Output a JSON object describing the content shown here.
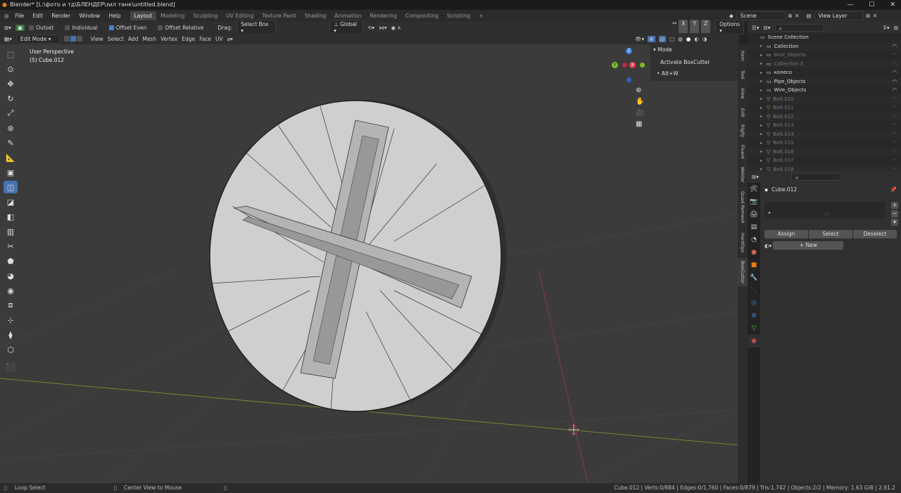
{
  "title_bar": {
    "text": "Blender* [L:\\фото и тд\\БЛЕНДЕР\\зил танк\\untitled.blend]"
  },
  "menu": [
    "File",
    "Edit",
    "Render",
    "Window",
    "Help"
  ],
  "workspaces": [
    "Layout",
    "Modeling",
    "Sculpting",
    "UV Editing",
    "Texture Paint",
    "Shading",
    "Animation",
    "Rendering",
    "Compositing",
    "Scripting"
  ],
  "scene": {
    "label": "Scene",
    "view_layer": "View Layer"
  },
  "tool_settings": {
    "outset": "Outset",
    "individual": "Individual",
    "offset_even": "Offset Even",
    "offset_relative": "Offset Relative",
    "drag_label": "Drag:",
    "drag_value": "Select Box",
    "orientation": "Global",
    "options": "Options"
  },
  "viewport_header": {
    "mode": "Edit Mode",
    "items": [
      "View",
      "Select",
      "Add",
      "Mesh",
      "Vertex",
      "Edge",
      "Face",
      "UV"
    ]
  },
  "viewport": {
    "perspective": "User Perspective",
    "object": "(5) Cube.012"
  },
  "gizmo": {
    "x": "X",
    "y": "Y",
    "z": "Z",
    "colors": {
      "x": "#e0404f",
      "y": "#7fbd2a",
      "z": "#3d84e6"
    }
  },
  "npanel": {
    "header": "Mode",
    "activate": "Activate BoxCutter",
    "shortcut": "• Alt+W",
    "tabs": [
      "Item",
      "Tool",
      "View",
      "Edit",
      "Rigify",
      "Fluent",
      "Welder",
      "Quad Remesh",
      "HardOps",
      "BoxCutter"
    ]
  },
  "outliner": {
    "root": "Scene Collection",
    "rows": [
      {
        "name": "Collection",
        "dim": false,
        "indent": 1
      },
      {
        "name": "Bool_Objects",
        "dim": true,
        "indent": 1
      },
      {
        "name": "Collection 3",
        "dim": true,
        "indent": 1
      },
      {
        "name": "колесо",
        "dim": false,
        "indent": 1
      },
      {
        "name": "Pipe_Objects",
        "dim": false,
        "indent": 1
      },
      {
        "name": "Wire_Objects",
        "dim": false,
        "indent": 1
      },
      {
        "name": "Bolt.010",
        "dim": true,
        "indent": 1
      },
      {
        "name": "Bolt.011",
        "dim": true,
        "indent": 1
      },
      {
        "name": "Bolt.012",
        "dim": true,
        "indent": 1
      },
      {
        "name": "Bolt.013",
        "dim": true,
        "indent": 1
      },
      {
        "name": "Bolt.014",
        "dim": true,
        "indent": 1
      },
      {
        "name": "Bolt.015",
        "dim": true,
        "indent": 1
      },
      {
        "name": "Bolt.016",
        "dim": true,
        "indent": 1
      },
      {
        "name": "Bolt.017",
        "dim": true,
        "indent": 1
      },
      {
        "name": "Bolt.018",
        "dim": true,
        "indent": 1
      }
    ]
  },
  "properties": {
    "object": "Cube.012",
    "assign": "Assign",
    "select": "Select",
    "deselect": "Deselect",
    "new": "New"
  },
  "status": {
    "left": "Loop Select",
    "mid": "Center View to Mouse",
    "right": "Cube.012 | Verts:0/884 | Edges:0/1,760 | Faces:0/879 | Tris:1,742 | Objects:2/2 | Memory: 1.63 GiB | 2.91.2"
  }
}
